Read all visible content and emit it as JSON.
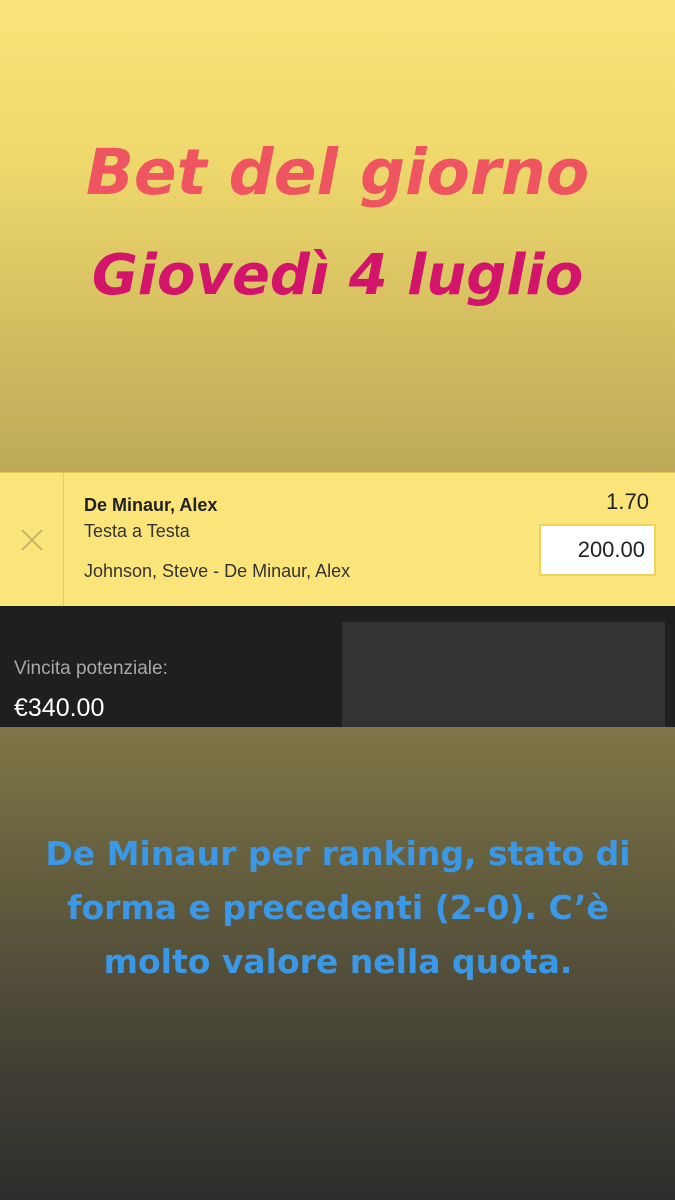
{
  "header": {
    "title": "Bet del giorno",
    "date": "Giovedì 4 luglio"
  },
  "bet_slip": {
    "selection": "De Minaur, Alex",
    "market": "Testa a Testa",
    "event": "Johnson, Steve - De Minaur, Alex",
    "odds": "1.70",
    "stake": "200.00",
    "remove_icon": "close-icon"
  },
  "summary": {
    "potential_win_label": "Vincita potenziale:",
    "potential_win_value": "€340.00"
  },
  "caption": {
    "text": "De Minaur per ranking, stato di forma e precedenti (2-0). C’è molto valore nella quota."
  },
  "colors": {
    "title": "#ef5561",
    "date": "#d3146b",
    "caption": "#3b98e6",
    "slip_background": "#fbe57a",
    "dark_bar": "#1f1f1f"
  }
}
